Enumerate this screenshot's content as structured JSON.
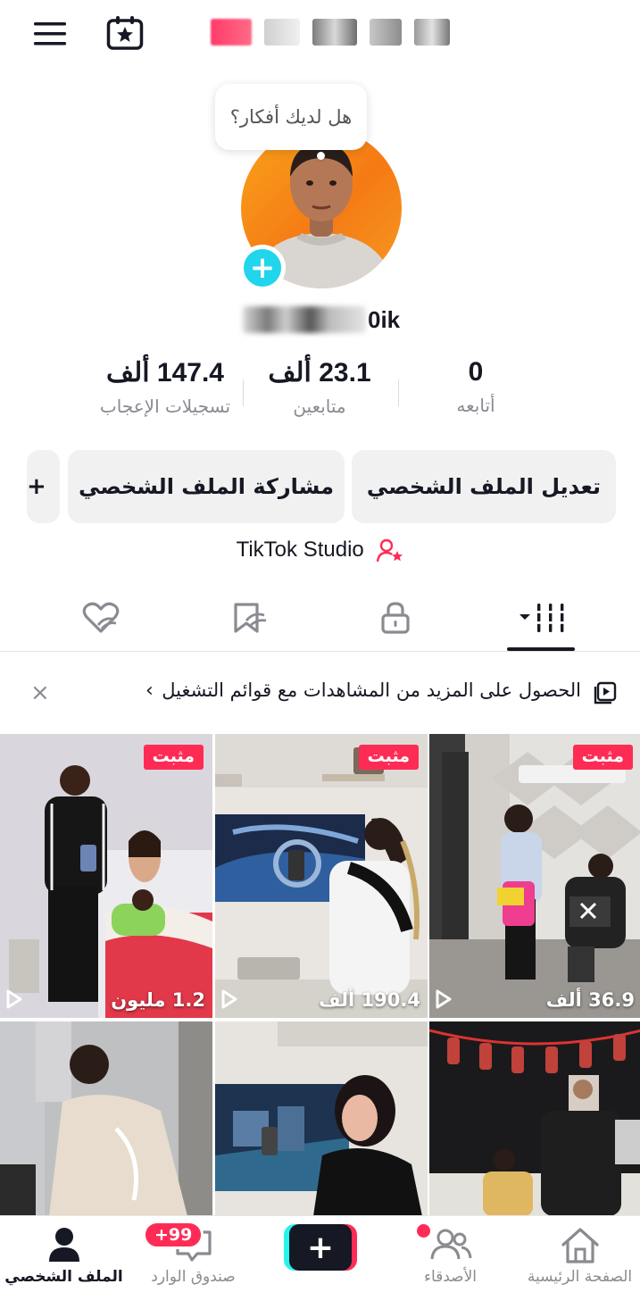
{
  "tooltip": {
    "text": "هل لديك أفكار؟"
  },
  "profile": {
    "username_visible": "0ik"
  },
  "stats": [
    {
      "value": "0",
      "label": "أتابعه"
    },
    {
      "value": "23.1 ألف",
      "label": "متابعين"
    },
    {
      "value": "147.4 ألف",
      "label": "تسجيلات الإعجاب"
    }
  ],
  "actions": {
    "edit_profile": "تعديل الملف الشخصي",
    "share_profile": "مشاركة الملف الشخصي",
    "add": "+"
  },
  "studio": {
    "label": "TikTok Studio"
  },
  "banner": {
    "text": "الحصول على المزيد من المشاهدات مع قوائم التشغيل",
    "chevron": "‹",
    "close": "×"
  },
  "videos": [
    {
      "pinned": "مثبت",
      "views": "1.2 مليون"
    },
    {
      "pinned": "مثبت",
      "views": "190.4 ألف"
    },
    {
      "pinned": "مثبت",
      "views": "36.9 ألف"
    },
    {
      "pinned": "",
      "views": ""
    },
    {
      "pinned": "",
      "views": ""
    },
    {
      "pinned": "",
      "views": ""
    }
  ],
  "nav": {
    "home": "الصفحة الرئيسية",
    "friends": "الأصدقاء",
    "create": "+",
    "inbox": "صندوق الوارد",
    "inbox_badge": "+99",
    "profile": "الملف الشخصي"
  },
  "colors": {
    "accent": "#fe2c55",
    "cyan": "#20d5ec",
    "text": "#161823",
    "muted": "#8a8b91"
  }
}
